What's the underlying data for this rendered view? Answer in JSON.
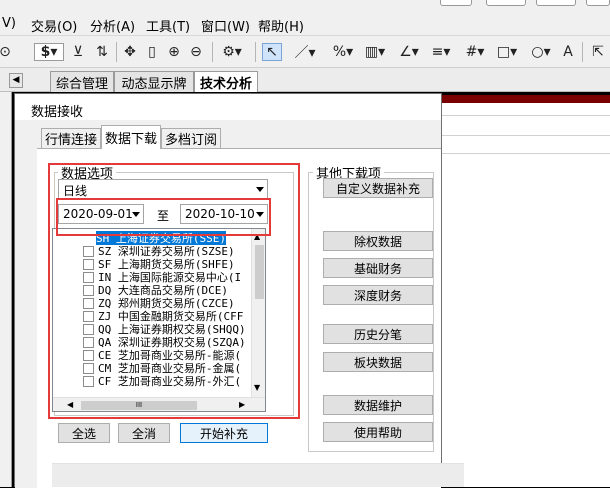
{
  "menubar": {
    "items": [
      "V)",
      "交易(O)",
      "分析(A)",
      "工具(T)",
      "窗口(W)",
      "帮助(H)"
    ]
  },
  "main_tabs": [
    "综合管理",
    "动态显示牌",
    "技术分析"
  ],
  "dialog": {
    "title": "数据接收",
    "tabs": [
      "行情连接",
      "数据下载",
      "多档订阅"
    ],
    "data_options": {
      "label": "数据选项",
      "period": "日线",
      "start_date": "2020-09-01",
      "to": "至",
      "end_date": "2020-10-10"
    },
    "markets": [
      "SH 上海证券交易所(SSE)",
      "SZ 深圳证券交易所(SZSE)",
      "SF 上海期货交易所(SHFE)",
      "IN 上海国际能源交易中心(I",
      "DQ 大连商品交易所(DCE)",
      "ZQ 郑州期货交易所(CZCE)",
      "ZJ 中国金融期货交易所(CFF",
      "QQ 上海证券期权交易(SHQQ)",
      "QA 深圳证券期权交易(SZQA)",
      "CE 芝加哥商业交易所-能源(",
      "CM 芝加哥商业交易所-金属(",
      "CF 芝加哥商业交易所-外汇("
    ],
    "hscroll_grip": "III",
    "buttons": {
      "select_all": "全选",
      "deselect_all": "全消",
      "start_fill": "开始补充"
    },
    "other": {
      "label": "其他下载项",
      "custom_fill": "自定义数据补充",
      "ex_rights": "除权数据",
      "fundamental": "基础财务",
      "deep_finance": "深度财务",
      "tick_history": "历史分笔",
      "sector_data": "板块数据",
      "maintenance": "数据维护",
      "help": "使用帮助"
    }
  },
  "colors": {
    "highlight_red": "#e53a3a",
    "selected_row": "#0078d7"
  }
}
